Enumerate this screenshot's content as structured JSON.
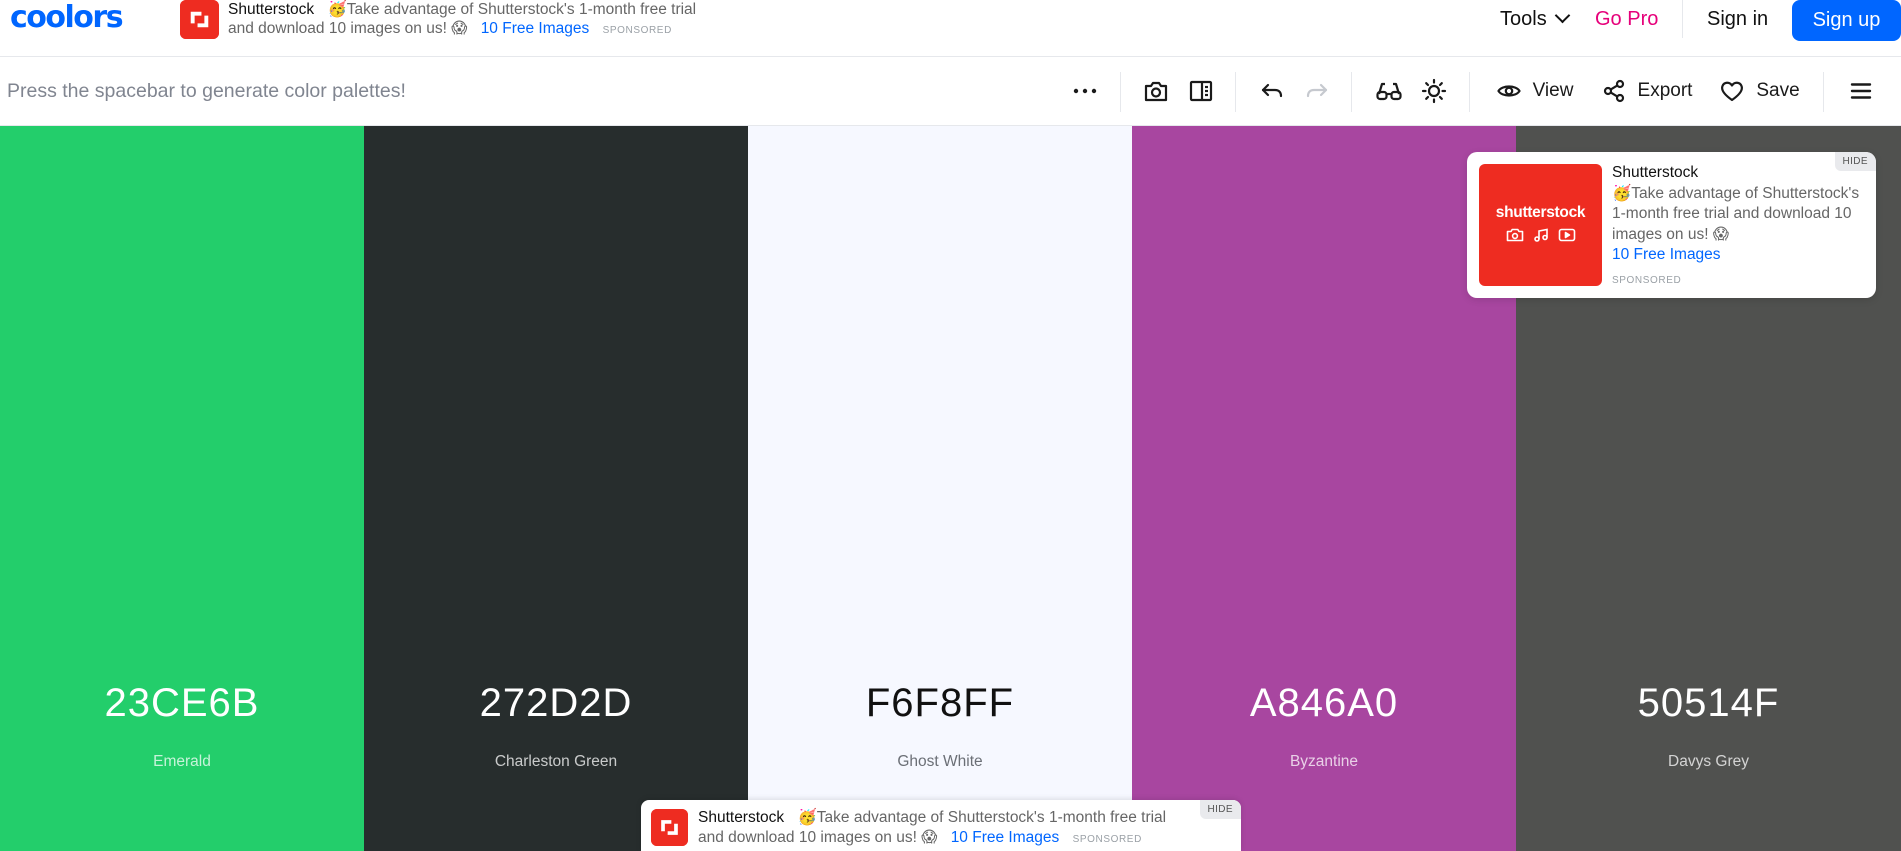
{
  "nav": {
    "logo": "coolors",
    "tools_label": "Tools",
    "gopro_label": "Go Pro",
    "signin_label": "Sign in",
    "signup_label": "Sign up"
  },
  "ads": {
    "brand": "Shutterstock",
    "text_line1": "🥳Take advantage of Shutterstock's 1-month free trial",
    "text_line2": "and download 10 images on us! 😱",
    "link": "10 Free Images",
    "sponsored": "SPONSORED",
    "hide": "HIDE",
    "card_text": "🥳Take advantage of Shutterstock's 1-month free trial and download 10 images on us! 😱",
    "card_wordmark": "shutterstock",
    "logo_color": "#ee2c21"
  },
  "toolbar": {
    "hint": "Press the spacebar to generate color palettes!",
    "view_label": "View",
    "export_label": "Export",
    "save_label": "Save",
    "icons": [
      "more-icon",
      "camera-icon",
      "side-panel-icon",
      "undo-icon",
      "redo-icon",
      "glasses-icon",
      "brightness-icon",
      "eye-icon",
      "share-icon",
      "heart-icon",
      "menu-icon"
    ]
  },
  "palette": {
    "colors": [
      {
        "hex": "23CE6B",
        "name": "Emerald",
        "bg": "#23CE6B",
        "text_color": "#ffffff",
        "name_color": "rgba(255,255,255,0.75)"
      },
      {
        "hex": "272D2D",
        "name": "Charleston Green",
        "bg": "#272D2D",
        "text_color": "#ffffff",
        "name_color": "rgba(255,255,255,0.75)"
      },
      {
        "hex": "F6F8FF",
        "name": "Ghost White",
        "bg": "#F6F8FF",
        "text_color": "#111111",
        "name_color": "#6b6f76"
      },
      {
        "hex": "A846A0",
        "name": "Byzantine",
        "bg": "#A846A0",
        "text_color": "#ffffff",
        "name_color": "rgba(255,255,255,0.75)"
      },
      {
        "hex": "50514F",
        "name": "Davys Grey",
        "bg": "#50514F",
        "text_color": "#ffffff",
        "name_color": "rgba(255,255,255,0.75)"
      }
    ]
  },
  "colors": {
    "accent": "#0066ff",
    "gopro": "#e6007a"
  }
}
